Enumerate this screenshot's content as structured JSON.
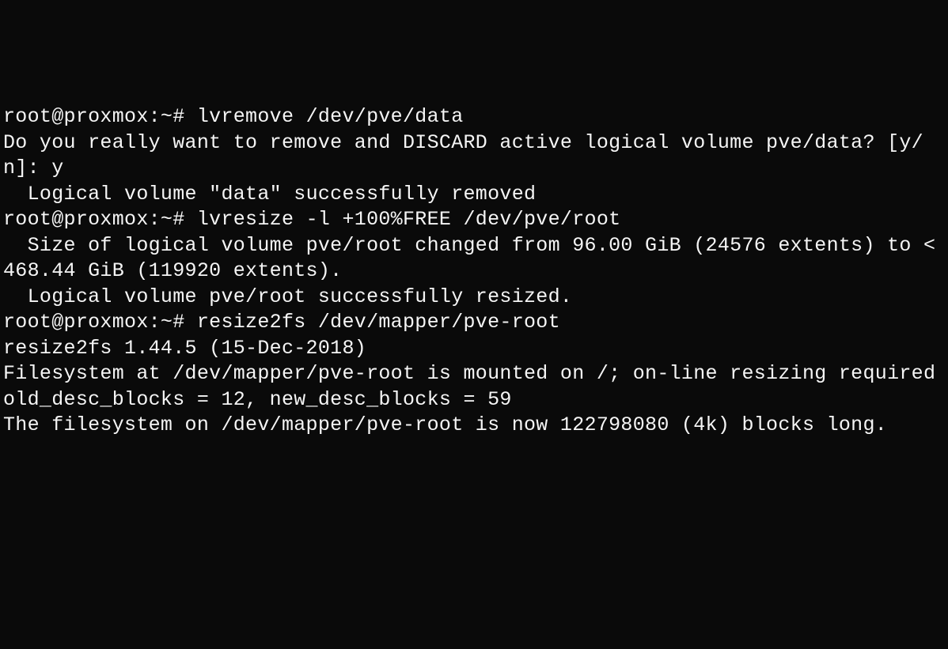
{
  "terminal": {
    "lines": [
      {
        "type": "prompt_cmd",
        "prompt": "root@proxmox:~# ",
        "command": "lvremove /dev/pve/data"
      },
      {
        "type": "output",
        "text": "Do you really want to remove and DISCARD active logical volume pve/data? [y/n]: y"
      },
      {
        "type": "output",
        "text": "  Logical volume \"data\" successfully removed"
      },
      {
        "type": "prompt_cmd",
        "prompt": "root@proxmox:~# ",
        "command": "lvresize -l +100%FREE /dev/pve/root"
      },
      {
        "type": "output",
        "text": "  Size of logical volume pve/root changed from 96.00 GiB (24576 extents) to <468.44 GiB (119920 extents)."
      },
      {
        "type": "output",
        "text": "  Logical volume pve/root successfully resized."
      },
      {
        "type": "prompt_cmd",
        "prompt": "root@proxmox:~# ",
        "command": "resize2fs /dev/mapper/pve-root"
      },
      {
        "type": "output",
        "text": "resize2fs 1.44.5 (15-Dec-2018)"
      },
      {
        "type": "output",
        "text": "Filesystem at /dev/mapper/pve-root is mounted on /; on-line resizing required"
      },
      {
        "type": "output",
        "text": "old_desc_blocks = 12, new_desc_blocks = 59"
      },
      {
        "type": "output",
        "text": "The filesystem on /dev/mapper/pve-root is now 122798080 (4k) blocks long."
      }
    ]
  }
}
